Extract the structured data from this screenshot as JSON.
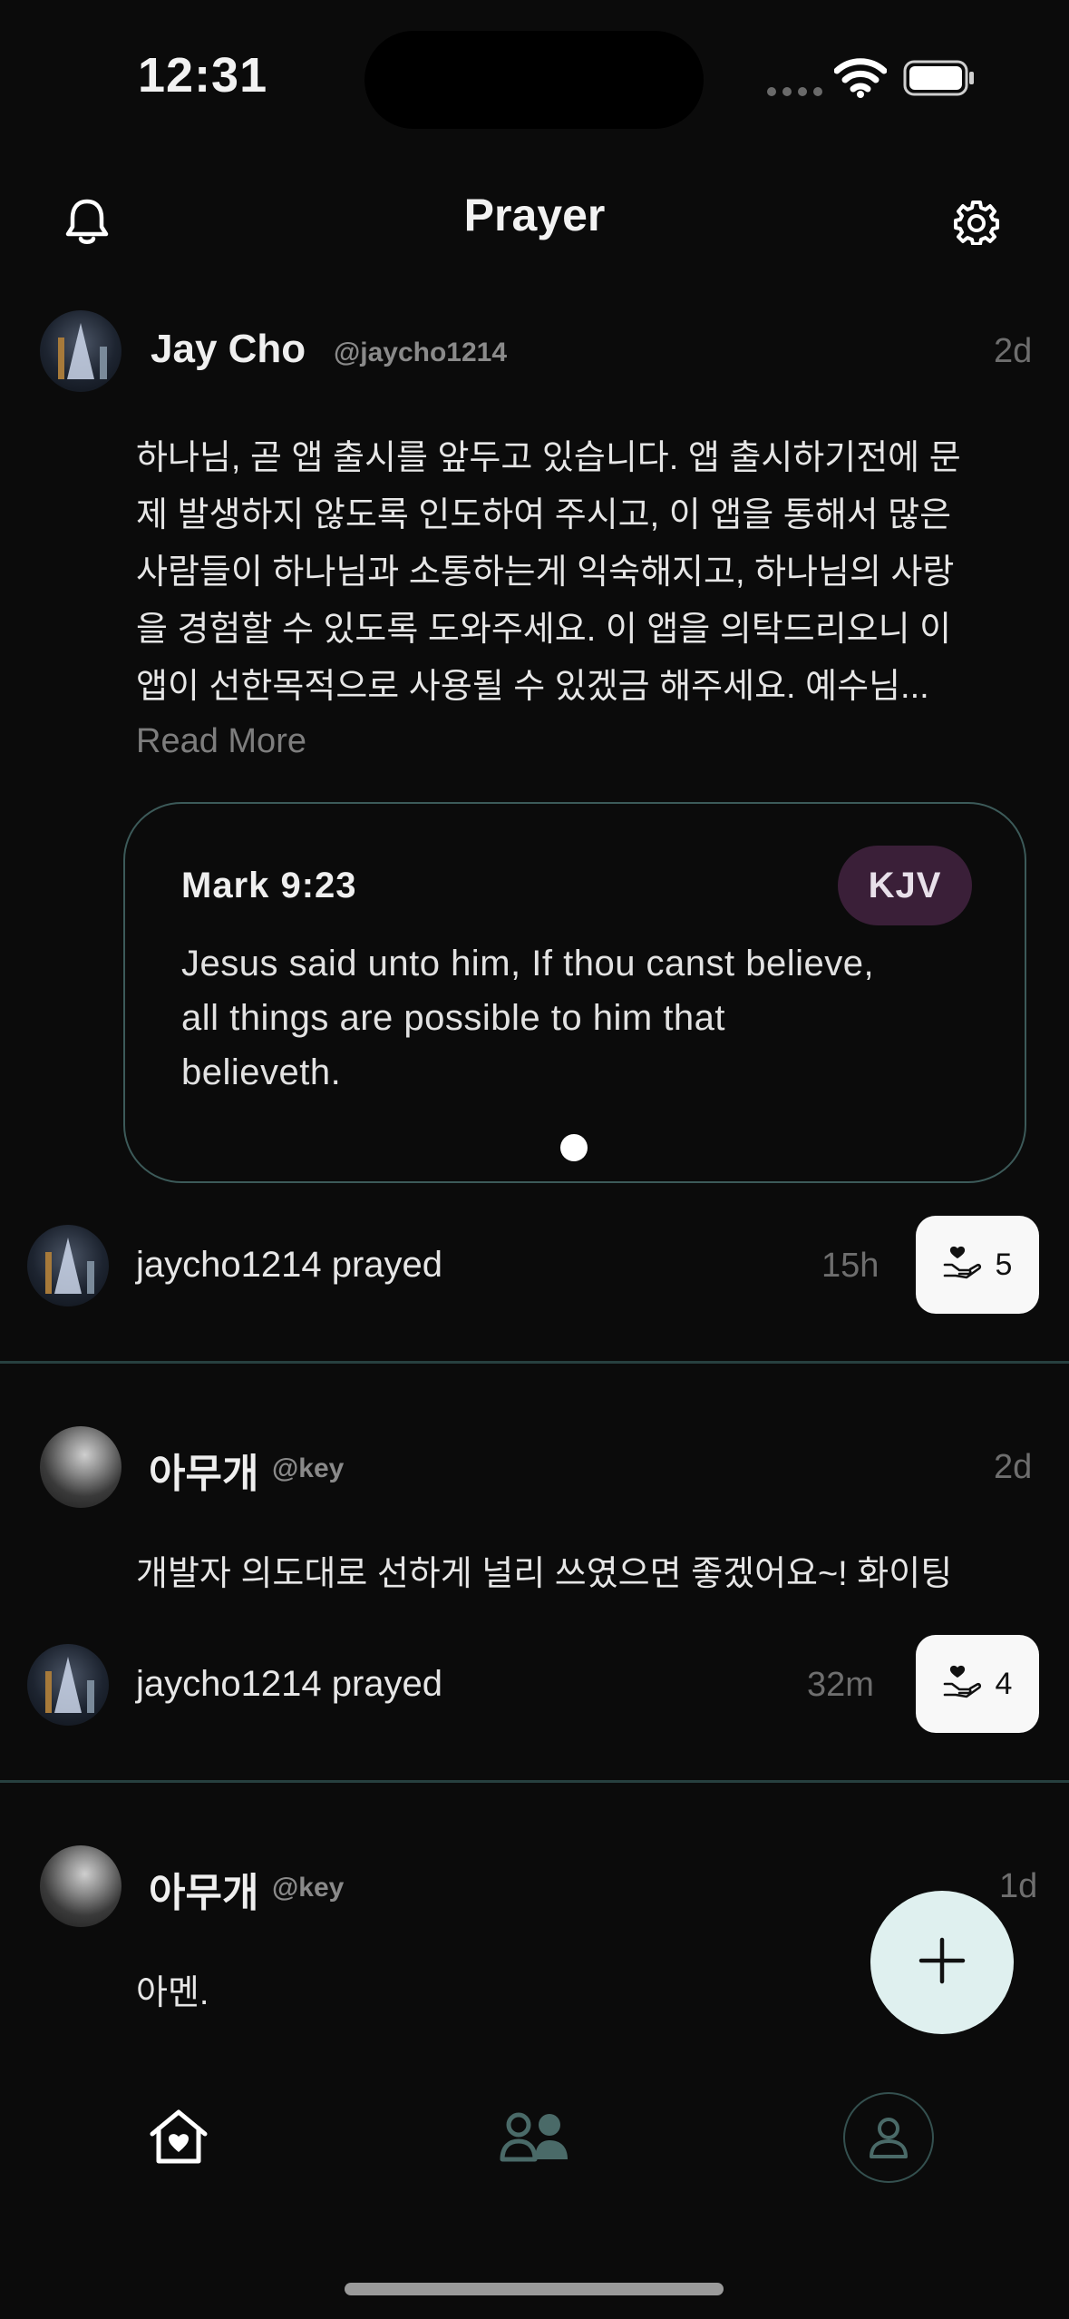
{
  "status_bar": {
    "time": "12:31"
  },
  "header": {
    "title": "Prayer",
    "left_icon": "bell-icon",
    "right_icon": "gear-icon"
  },
  "posts": [
    {
      "author": "Jay Cho",
      "handle": "@jaycho1214",
      "ago": "2d",
      "text_lines": [
        "하나님, 곧 앱 출시를 앞두고 있습니다. 앱 출시하기전에 문",
        "제 발생하지 않도록 인도하여 주시고, 이 앱을 통해서 많은",
        "사람들이 하나님과 소통하는게 익숙해지고, 하나님의 사랑",
        "을 경험할 수 있도록 도와주세요. 이 앱을 의탁드리오니 이",
        "앱이 선한목적으로 사용될 수 있겠금 해주세요. 예수님..."
      ],
      "read_more": "Read More",
      "verse": {
        "reference": "Mark 9:23",
        "version": "KJV",
        "text_lines": [
          "Jesus said unto him, If thou canst believe,",
          "all things are possible to him that",
          "believeth."
        ]
      },
      "prayed_text": "jaycho1214 prayed",
      "prayed_ago": "15h",
      "pray_count": "5"
    },
    {
      "author": "아무개",
      "handle": "@key",
      "ago": "2d",
      "text": "개발자 의도대로 선하게 널리 쓰였으면 좋겠어요~! 화이팅",
      "prayed_text": "jaycho1214 prayed",
      "prayed_ago": "32m",
      "pray_count": "4"
    },
    {
      "author": "아무개",
      "handle": "@key",
      "ago": "1d",
      "text": "아멘."
    }
  ],
  "fab": {
    "icon": "plus-icon"
  },
  "tab_bar": {
    "items": [
      "home-heart-icon",
      "people-icon",
      "profile-icon"
    ]
  },
  "colors": {
    "background": "#0b0b0b",
    "accent": "#dff0ef",
    "divider": "#27403f",
    "kjv_badge": "#3a1f38"
  }
}
